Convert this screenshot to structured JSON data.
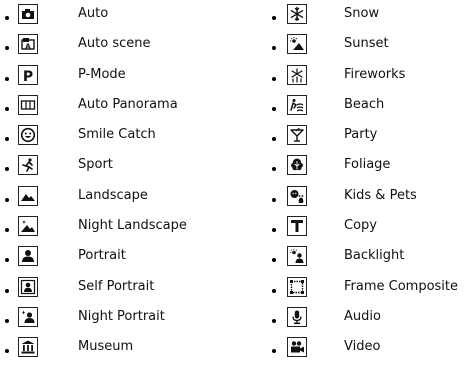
{
  "left_column": [
    {
      "label": "Auto",
      "icon": "camera-icon"
    },
    {
      "label": "Auto scene",
      "icon": "auto-scene-icon"
    },
    {
      "label": "P-Mode",
      "icon": "p-mode-icon"
    },
    {
      "label": "Auto Panorama",
      "icon": "panorama-icon"
    },
    {
      "label": "Smile Catch",
      "icon": "smile-icon"
    },
    {
      "label": "Sport",
      "icon": "sport-icon"
    },
    {
      "label": "Landscape",
      "icon": "landscape-icon"
    },
    {
      "label": "Night Landscape",
      "icon": "night-landscape-icon"
    },
    {
      "label": "Portrait",
      "icon": "portrait-icon"
    },
    {
      "label": "Self Portrait",
      "icon": "self-portrait-icon"
    },
    {
      "label": "Night Portrait",
      "icon": "night-portrait-icon"
    },
    {
      "label": "Museum",
      "icon": "museum-icon"
    }
  ],
  "right_column": [
    {
      "label": "Snow",
      "icon": "snowflake-icon"
    },
    {
      "label": "Sunset",
      "icon": "sunset-icon"
    },
    {
      "label": "Fireworks",
      "icon": "fireworks-icon"
    },
    {
      "label": "Beach",
      "icon": "beach-icon"
    },
    {
      "label": "Party",
      "icon": "party-icon"
    },
    {
      "label": "Foliage",
      "icon": "foliage-icon"
    },
    {
      "label": "Kids & Pets",
      "icon": "kids-pets-icon"
    },
    {
      "label": "Copy",
      "icon": "copy-icon"
    },
    {
      "label": "Backlight",
      "icon": "backlight-icon"
    },
    {
      "label": "Frame Composite",
      "icon": "frame-composite-icon"
    },
    {
      "label": "Audio",
      "icon": "microphone-icon"
    },
    {
      "label": "Video",
      "icon": "video-icon"
    }
  ]
}
